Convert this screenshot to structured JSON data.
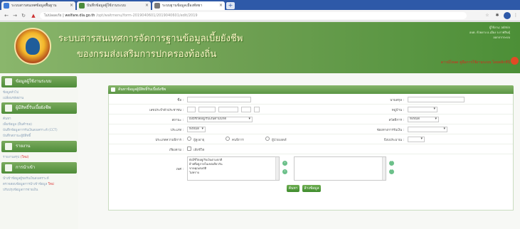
{
  "browser": {
    "tabs": [
      {
        "label": "ระบบสารสนเทศข้อมูลพื้นฐาน",
        "color": "#3f7bd6"
      },
      {
        "label": "บันทึกข้อมูลผู้ใช้งานระบบ",
        "color": "#4b8b3b"
      },
      {
        "label": "ระบบฐานข้อมูลเมืองพัทยา",
        "color": "#7a7a7a"
      }
    ],
    "new_tab_label": "+",
    "url": {
      "security": "ไม่ปลอดภัย",
      "host": "welfare.dla.go.th",
      "path": "/opt/waitmenu/form-2019040601/2019040601/edit/2019"
    }
  },
  "header": {
    "title_line1": "ระบบสารสนเทศการจัดการฐานข้อมูลเบี้ยยังชีพ",
    "title_line2": "ของกรมส่งเสริมการปกครองท้องถิ่น",
    "info_lines": [
      "ผู้ใช้งาน: admin",
      "อบต. ห้วยยาง อ.เมือง จ.กาฬสินธุ์",
      "ออกจากระบบ"
    ],
    "link_text": "ดาวน์โหลด คู่มือการใช้งานระบบ โดยคลิกที่นี่",
    "accent": "#4c8f37"
  },
  "sidebar": {
    "sections": [
      {
        "title": "ข้อมูลผู้ใช้งานระบบ",
        "icon": "user-card-icon",
        "items": [
          "ข้อมูลทั่วไป",
          "เปลี่ยนรหัสผ่าน"
        ]
      },
      {
        "title": "ผู้มีสิทธิ์รับเบี้ยยังชีพ",
        "icon": "people-icon",
        "items": [
          "ค้นหา",
          "เพิ่มข้อมูล (ยื่นคำขอ)",
          "บันทึกข้อมูลการรับเงินสงเคราะห์ (CCT)",
          "บันทึกสถานะผู้มีสิทธิ์"
        ]
      },
      {
        "title": "รายงาน",
        "icon": "report-icon",
        "items": [
          "รายงานสรุป",
          "(ใหม่)"
        ]
      },
      {
        "title": "การนำเข้า",
        "icon": "import-icon",
        "items": [
          "นำเข้าข้อมูลผู้ขอรับเงินสงเคราะห์",
          "ตรวจสอบข้อมูลการนำเข้าข้อมูล",
          "ใหม่",
          "ปรับปรุงข้อมูลการจ่ายเงิน"
        ]
      }
    ]
  },
  "form": {
    "panel_title": "ค้นหาข้อมูลผู้มีสิทธิ์รับเบี้ยยังชีพ",
    "labels": {
      "name": "ชื่อ :",
      "citizen_id": "เลขประจำตัวประชาชน :",
      "status": "สถานะ :",
      "type": "ประเภท :",
      "payment_channel": "ช่องทางการรับเงิน :",
      "disabled_type": "ประเภทความพิการ :",
      "age_from": "อายุ :",
      "sex": "เพศ :",
      "sort": "เรียงตาม :",
      "surname": "นามสกุล :",
      "village": "หมู่บ้าน :",
      "welfare": "สวัสดิการ :",
      "year": "ปีงบประมาณ :"
    },
    "values": {
      "status_selected": "ยังมีชีวิตอยู่/รับเงินตามปกติ",
      "type_selected": "ทั้งหมด",
      "age_selected": "ทั้งหมด",
      "sex_selected": "",
      "radios": [
        "ผู้สูงอายุ",
        "คนพิการ",
        "ผู้ป่วยเอดส์"
      ],
      "checkbox_label": "เสียชีวิต",
      "list_items": [
        "ยังมีชีวิตอยู่/รับเงินตามปกติ",
        "ย้ายที่อยู่ภายในเขตเดียวกัน",
        "ขาดคุณสมบัติ",
        "ไม่ทราบ"
      ]
    },
    "buttons": {
      "search": "ค้นหา",
      "clear": "ล้างข้อมูล"
    }
  }
}
